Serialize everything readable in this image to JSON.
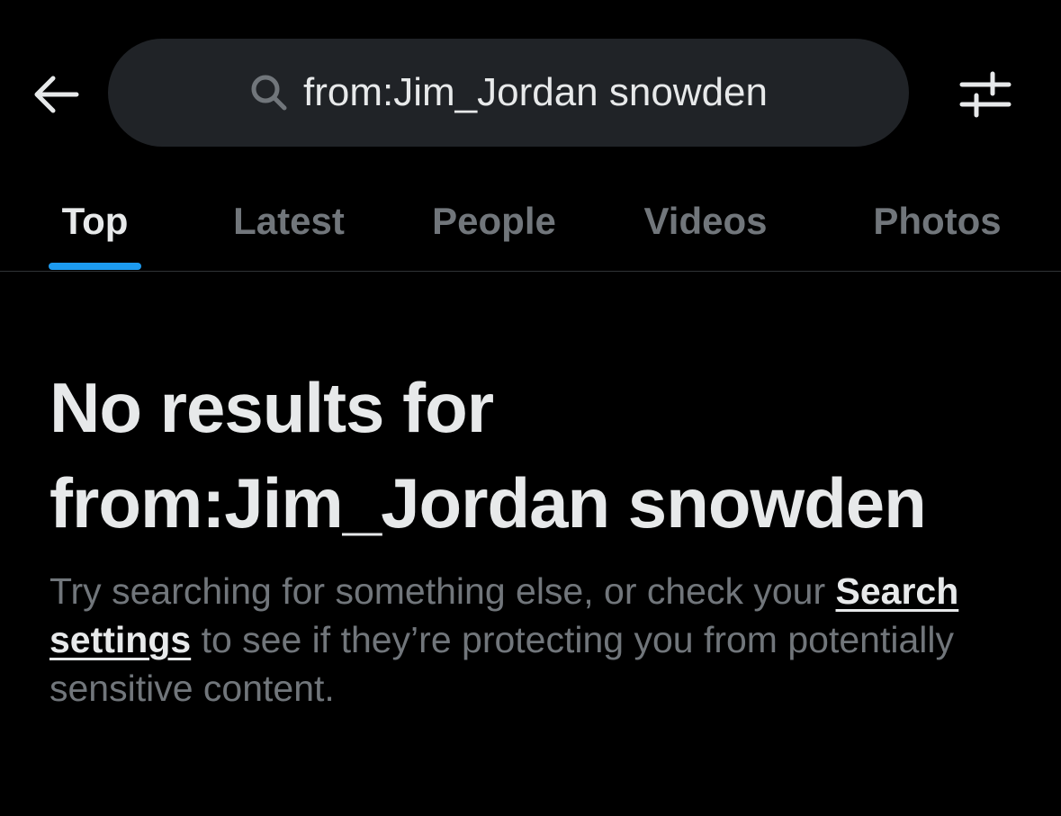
{
  "search": {
    "query": "from:Jim_Jordan snowden"
  },
  "icons": {
    "back": "arrow-left-icon",
    "search": "search-icon",
    "filter": "sliders-icon"
  },
  "tabs": [
    {
      "label": "Top",
      "active": true
    },
    {
      "label": "Latest",
      "active": false
    },
    {
      "label": "People",
      "active": false
    },
    {
      "label": "Videos",
      "active": false
    },
    {
      "label": "Photos",
      "active": false
    }
  ],
  "empty_state": {
    "title_line1": "No results for",
    "title_line2": "from:Jim_Jordan snowden",
    "desc_before": "Try searching for something else, or check your ",
    "link_label": "Search settings",
    "desc_after": " to see if they’re protecting you from potentially sensitive content."
  },
  "colors": {
    "background": "#000000",
    "search_pill": "#202327",
    "accent": "#1d9bf0",
    "text_primary": "#e7e9ea",
    "text_secondary": "#71767b",
    "divider": "#2f3336"
  }
}
